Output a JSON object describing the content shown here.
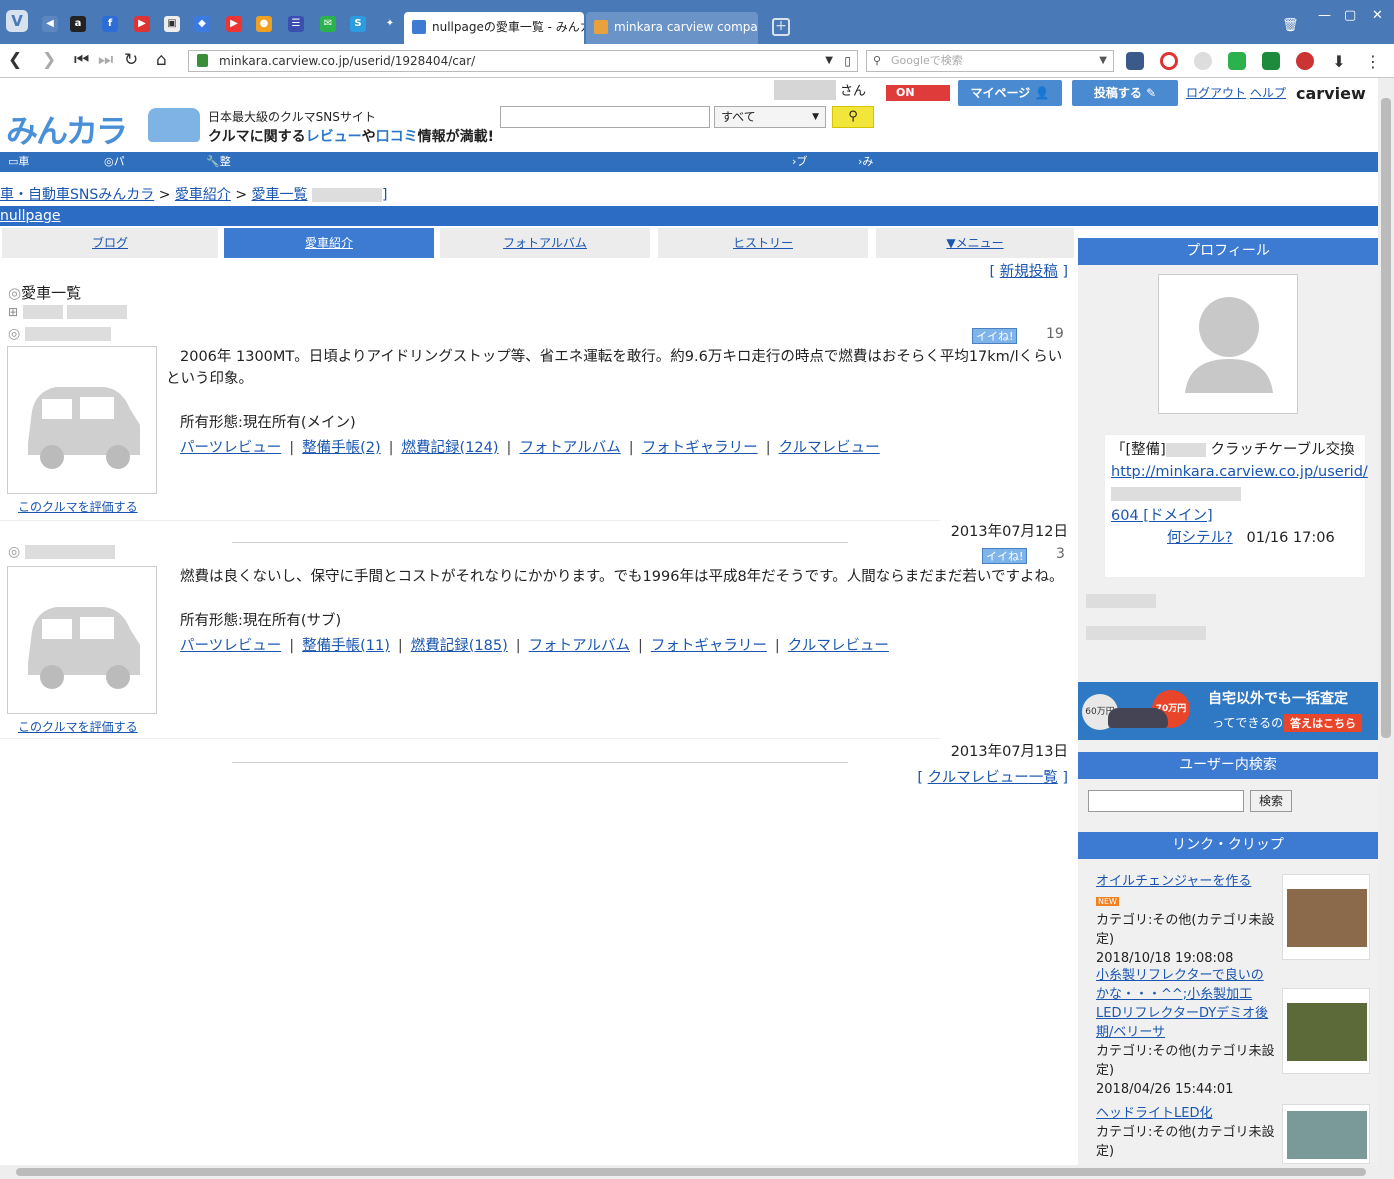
{
  "browser": {
    "tabs": [
      {
        "title": "nullpageの愛車一覧 - みんカラ",
        "active": true
      },
      {
        "title": "minkara carview compact",
        "active": false
      }
    ],
    "url": "minkara.carview.co.jp/userid/1928404/car/",
    "search_placeholder": "Googleで検索"
  },
  "header": {
    "logo": "みんカラ",
    "tagline": "日本最大級のクルマSNSサイト",
    "catch_1": "クルマに関する",
    "catch_2": "レビュー",
    "catch_3": "や",
    "catch_4": "口コミ",
    "catch_5": "情報が満載!",
    "search_scope": "すべて",
    "san": "さん",
    "on_label": "ON",
    "mypage": "マイページ",
    "post": "投稿する",
    "logout": "ログアウト",
    "help": "ヘルプ",
    "carview": "carview",
    "nav": [
      "車種別情報",
      "パーツレビュー",
      "整備手帳",
      "ブログ",
      "みんカラ+"
    ]
  },
  "breadcrumb": {
    "home": "車・自動車SNSみんカラ",
    "sep": ">",
    "intro": "愛車紹介",
    "list": "愛車一覧"
  },
  "user": {
    "name": "nullpage"
  },
  "profile_tabs": [
    "ブログ",
    "愛車紹介",
    "フォトアルバム",
    "ヒストリー",
    "▼メニュー"
  ],
  "main": {
    "new_post": "新規投稿",
    "section_title": "愛車一覧",
    "cars": [
      {
        "iine": "イイね!",
        "count": "19",
        "desc": "2006年 1300MT。日頃よりアイドリングストップ等、省エネ運転を敢行。約9.6万キロ走行の時点で燃費はおそらく平均17km/lくらいという印象。",
        "ownership": "所有形態:現在所有(メイン)",
        "links": [
          "パーツレビュー",
          "整備手帳(2)",
          "燃費記録(124)",
          "フォトアルバム",
          "フォトギャラリー",
          "クルマレビュー"
        ],
        "rate": "このクルマを評価する",
        "date": "2013年07月12日"
      },
      {
        "iine": "イイね!",
        "count": "3",
        "desc": "燃費は良くないし、保守に手間とコストがそれなりにかかります。でも1996年は平成8年だそうです。人間ならまだまだ若いですよね。",
        "ownership": "所有形態:現在所有(サブ)",
        "links": [
          "パーツレビュー",
          "整備手帳(11)",
          "燃費記録(185)",
          "フォトアルバム",
          "フォトギャラリー",
          "クルマレビュー"
        ],
        "rate": "このクルマを評価する",
        "date": "2013年07月13日"
      }
    ],
    "review_list": "クルマレビュー一覧"
  },
  "sidebar": {
    "profile_title": "プロフィール",
    "bubble_prefix": "「[整備]",
    "bubble_text": "クラッチケーブル交換",
    "bubble_url": "http://minkara.carview.co.jp/userid/",
    "bubble_tail": "604 [ドメイン]",
    "bubble_what": "何シテル?",
    "bubble_time": "01/16 17:06",
    "ad_line1": "自宅以外でも一括査定",
    "ad_line2": "ってできるの?",
    "ad_cta": "答えはこちら",
    "ad_price_a": "60万円",
    "ad_price_b": "70万円",
    "search_title": "ユーザー内検索",
    "search_btn": "検索",
    "clip_title": "リンク・クリップ",
    "clips": [
      {
        "title": "オイルチェンジャーを作る",
        "cat": "カテゴリ:その他(カテゴリ未設定)",
        "date": "2018/10/18 19:08:08",
        "new": "NEW"
      },
      {
        "title": "小糸製リフレクターで良いのかな・・・^^;小糸製加工LEDリフレクターDYデミオ後期/ベリーサ",
        "cat": "カテゴリ:その他(カテゴリ未設定)",
        "date": "2018/04/26 15:44:01"
      },
      {
        "title": "ヘッドライトLED化",
        "cat": "カテゴリ:その他(カテゴリ未設定)"
      }
    ]
  },
  "colors": {
    "accent": "#3c7bd1",
    "chrome": "#4a79b7",
    "link": "#1a56b0"
  }
}
